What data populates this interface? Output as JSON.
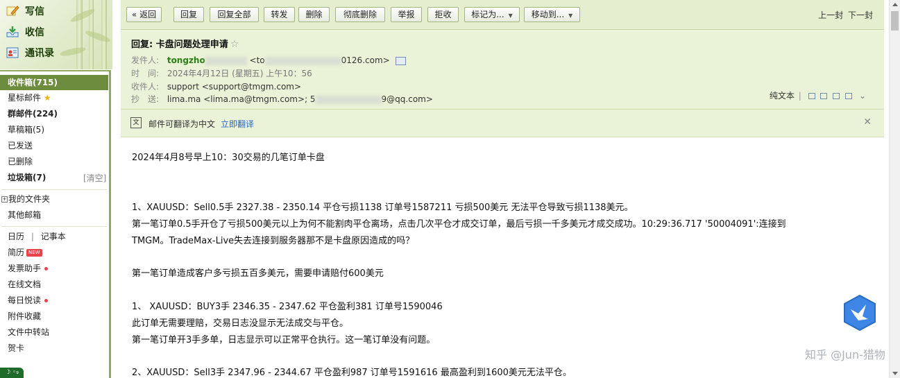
{
  "sidebar": {
    "top_nav": [
      {
        "label": "写信",
        "icon": "pencil-icon"
      },
      {
        "label": "收信",
        "icon": "inbox-download-icon"
      },
      {
        "label": "通讯录",
        "icon": "contacts-icon"
      }
    ],
    "inbox": "收件箱(715)",
    "folders": [
      "星标邮件",
      "群邮件(224)",
      "草稿箱(5)",
      "已发送",
      "已删除",
      "垃圾箱(7)"
    ],
    "clear": "[清空]",
    "my_folders": "我的文件夹",
    "other_mail": "其他邮箱",
    "calendar": "日历",
    "notes": "记事本",
    "resume": "简历",
    "resume_badge": "NEW",
    "apps": [
      "发票助手",
      "在线文档",
      "每日悦读",
      "附件收藏",
      "文件中转站",
      "贺卡"
    ]
  },
  "toolbar": {
    "back": "« 返回",
    "reply": "回复",
    "reply_all": "回复全部",
    "forward": "转发",
    "delete": "删除",
    "delete_perm": "彻底删除",
    "report": "举报",
    "reject": "拒收",
    "mark_as": "标记为...",
    "move_to": "移动到...",
    "prev": "上一封",
    "next": "下一封"
  },
  "header": {
    "subject": "回复: 卡盘问题处理申请",
    "sender_label": "发件人:",
    "sender_name": "tongzho",
    "sender_email_a": "<to",
    "sender_email_b": "0126.com>",
    "time_label": "时　间:",
    "time_value": "2024年4月12日 (星期五) 上午10：56",
    "to_label": "收件人:",
    "to_value": "support <support@tmgm.com>",
    "cc_label": "抄　送:",
    "cc_value_a": "lima.ma <lima.ma@tmgm.com>; 5",
    "cc_value_b": "9@qq.com>",
    "plain_text": "纯文本"
  },
  "translate": {
    "text": "邮件可翻译为中文",
    "link": "立即翻译"
  },
  "body": {
    "lines": [
      "2024年4月8号早上10：30交易的几笔订单卡盘",
      "1、XAUUSD：Sell0.5手 2327.38 - 2350.14 平仓亏损1138 订单号1587211 亏损500美元  无法平仓导致亏损1138美元。",
      "第一笔订单0.5手开仓了亏损500美元以上为何不能割肉平仓离场，点击几次平仓才成交订单，最后亏损一千多美元才成交成功。10:29:36.717 '50004091':连接到",
      "TMGM。TradeMax-Live失去连接到服务器那不是卡盘原因造成的吗？",
      "第一笔订单造成客户多亏损五百多美元，需要申请赔付600美元",
      " 1、 XAUUSD：BUY3手 2346.35 - 2347.62 平仓盈利381 订单号1590046",
      "此订单无需要理赔，交易日志没显示无法成交与平仓。",
      "第一笔订单开3手多单，日志显示可以正常平仓执行。这一笔订单没有问题。",
      "2、XAUUSD：Sell3手 2347.96 - 2344.67 平仓盈利987 订单号1591616 最高盈利到1600美元无法平仓。"
    ]
  },
  "watermark": "知乎 @Jun-猎物",
  "bottom_chip": "☽ ◦₉"
}
